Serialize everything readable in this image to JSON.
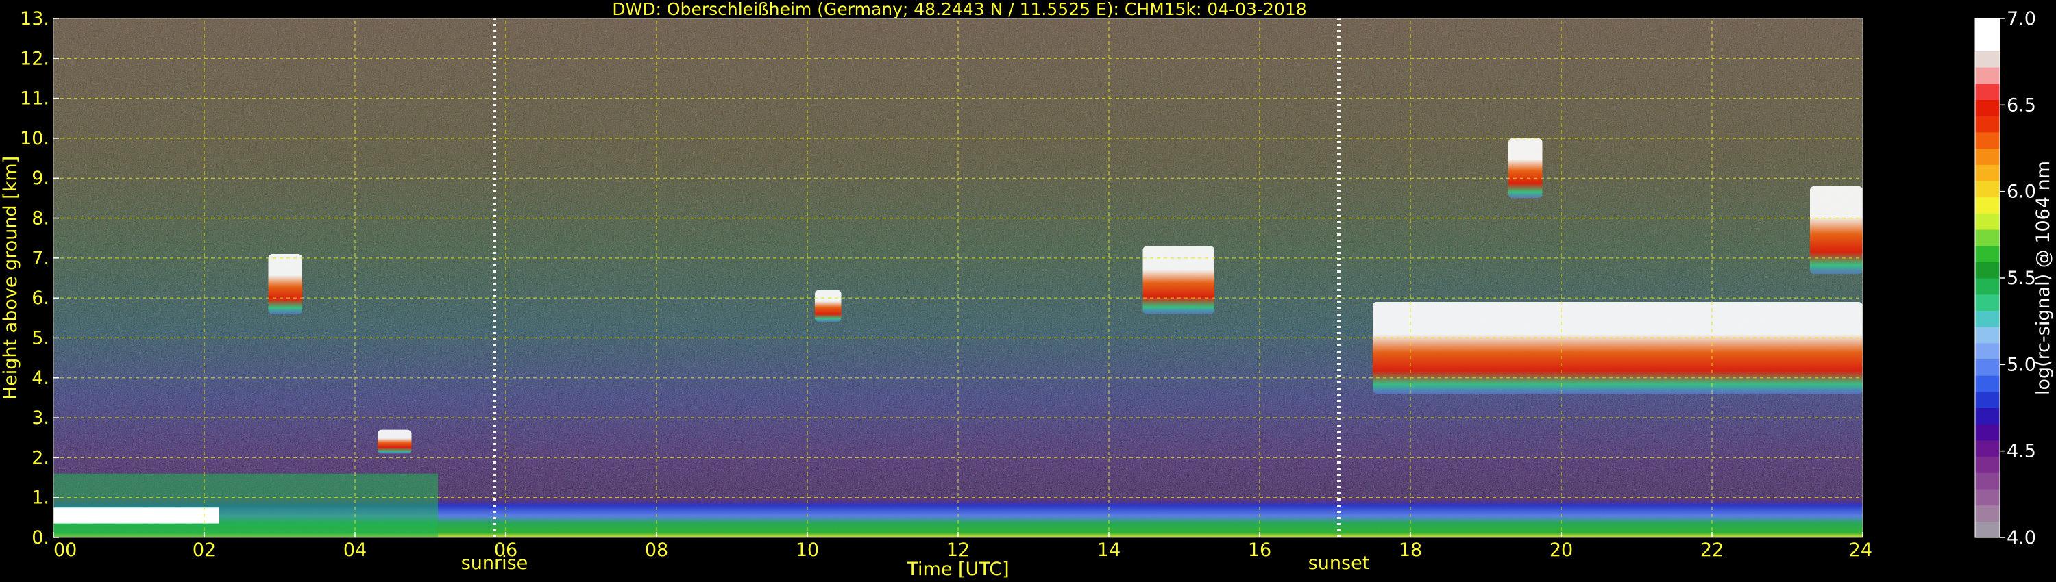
{
  "chart_data": {
    "type": "heatmap",
    "title": "DWD: Oberschleißheim (Germany; 48.2443 N / 11.5525 E):    CHM15k: 04-03-2018",
    "xlabel": "Time [UTC]",
    "ylabel": "Height above ground [km]",
    "xlim": [
      0,
      24
    ],
    "ylim": [
      0,
      13
    ],
    "x_ticks": [
      {
        "value": 0,
        "label": "00"
      },
      {
        "value": 2,
        "label": "02"
      },
      {
        "value": 4,
        "label": "04"
      },
      {
        "value": 6,
        "label": "06"
      },
      {
        "value": 8,
        "label": "08"
      },
      {
        "value": 10,
        "label": "10"
      },
      {
        "value": 12,
        "label": "12"
      },
      {
        "value": 14,
        "label": "14"
      },
      {
        "value": 16,
        "label": "16"
      },
      {
        "value": 18,
        "label": "18"
      },
      {
        "value": 20,
        "label": "20"
      },
      {
        "value": 22,
        "label": "22"
      },
      {
        "value": 24,
        "label": "24"
      }
    ],
    "y_ticks": [
      {
        "value": 0,
        "label": "0."
      },
      {
        "value": 1,
        "label": "1."
      },
      {
        "value": 2,
        "label": "2."
      },
      {
        "value": 3,
        "label": "3."
      },
      {
        "value": 4,
        "label": "4."
      },
      {
        "value": 5,
        "label": "5."
      },
      {
        "value": 6,
        "label": "6."
      },
      {
        "value": 7,
        "label": "7."
      },
      {
        "value": 8,
        "label": "8."
      },
      {
        "value": 9,
        "label": "9."
      },
      {
        "value": 10,
        "label": "10."
      },
      {
        "value": 11,
        "label": "11."
      },
      {
        "value": 12,
        "label": "12."
      },
      {
        "value": 13,
        "label": "13."
      }
    ],
    "grid": true,
    "markers": [
      {
        "name": "sunrise",
        "time": 5.85
      },
      {
        "name": "sunset",
        "time": 17.05
      }
    ],
    "colorbar": {
      "label": "log(rc-signal) @ 1064 nm",
      "range": [
        4.0,
        7.0
      ],
      "ticks": [
        {
          "value": 4.0,
          "label": "4.0"
        },
        {
          "value": 4.5,
          "label": "4.5"
        },
        {
          "value": 5.0,
          "label": "5.0"
        },
        {
          "value": 5.5,
          "label": "5.5"
        },
        {
          "value": 6.0,
          "label": "6.0"
        },
        {
          "value": 6.5,
          "label": "6.5"
        },
        {
          "value": 7.0,
          "label": "7.0"
        }
      ],
      "colors": [
        "#9f97a6",
        "#a07fa0",
        "#96609a",
        "#8a4794",
        "#7c2b8e",
        "#6a1591",
        "#4b0a9b",
        "#2c16b4",
        "#2438d2",
        "#3660ea",
        "#5b84f2",
        "#7fa5f5",
        "#8fc2ef",
        "#4fc7c7",
        "#33c883",
        "#22b452",
        "#1a9b2c",
        "#2fbd2f",
        "#7ad93a",
        "#c8ef32",
        "#f2f230",
        "#f6d426",
        "#f9b21c",
        "#f88d14",
        "#f2600e",
        "#ea3307",
        "#e41d05",
        "#f23c3c",
        "#f4a0a0",
        "#e6d7d2",
        "#ffffff",
        "#ffffff"
      ]
    },
    "features": [
      {
        "name": "boundary layer",
        "time_start": 0,
        "time_end": 24,
        "height_top_km": 1.0
      },
      {
        "name": "low cloud",
        "time_start": 0,
        "time_end": 5.1,
        "height_top_km": 1.6
      },
      {
        "name": "cloud",
        "time_start": 2.85,
        "time_end": 3.3,
        "height_bottom_km": 5.6,
        "height_top_km": 7.1
      },
      {
        "name": "cloud",
        "time_start": 4.3,
        "time_end": 4.75,
        "height_bottom_km": 2.1,
        "height_top_km": 2.7
      },
      {
        "name": "cloud",
        "time_start": 10.1,
        "time_end": 10.45,
        "height_bottom_km": 5.4,
        "height_top_km": 6.2
      },
      {
        "name": "cloud",
        "time_start": 14.45,
        "time_end": 15.4,
        "height_bottom_km": 5.6,
        "height_top_km": 7.3
      },
      {
        "name": "cloud layer",
        "time_start": 17.5,
        "time_end": 24,
        "height_bottom_km": 3.6,
        "height_top_km": 5.9
      },
      {
        "name": "cloud",
        "time_start": 19.3,
        "time_end": 19.75,
        "height_bottom_km": 8.5,
        "height_top_km": 10.0
      },
      {
        "name": "cloud",
        "time_start": 23.3,
        "time_end": 24,
        "height_bottom_km": 6.6,
        "height_top_km": 8.8
      }
    ]
  }
}
